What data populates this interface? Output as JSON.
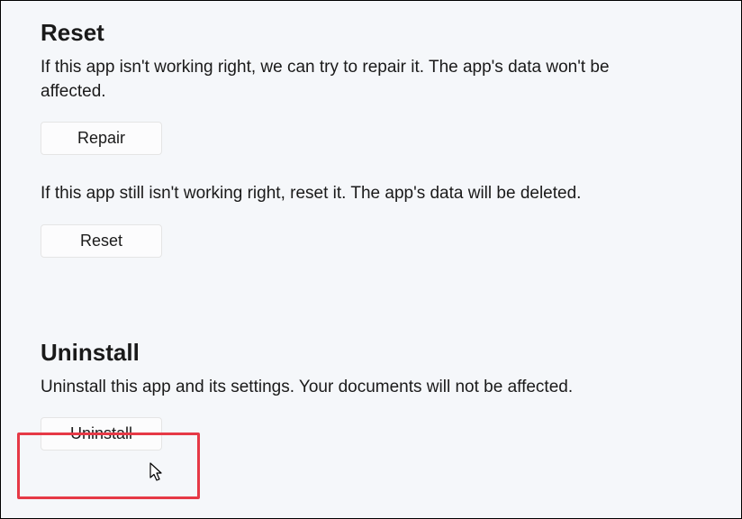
{
  "reset": {
    "heading": "Reset",
    "repair_description": "If this app isn't working right, we can try to repair it. The app's data won't be affected.",
    "repair_button_label": "Repair",
    "reset_description": "If this app still isn't working right, reset it. The app's data will be deleted.",
    "reset_button_label": "Reset"
  },
  "uninstall": {
    "heading": "Uninstall",
    "description": "Uninstall this app and its settings. Your documents will not be affected.",
    "button_label": "Uninstall"
  }
}
